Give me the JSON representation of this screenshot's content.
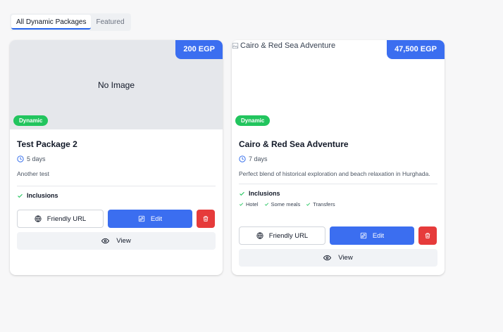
{
  "tabs": [
    {
      "label": "All Dynamic Packages",
      "active": true
    },
    {
      "label": "Featured",
      "active": false
    }
  ],
  "cards": [
    {
      "title": "Test Package 2",
      "price": "200 EGP",
      "badge": "Dynamic",
      "image_text": "No Image",
      "duration": "5 days",
      "description": "Another test",
      "inclusions_label": "Inclusions",
      "inclusions": [],
      "buttons": {
        "url": "Friendly URL",
        "edit": "Edit",
        "view": "View"
      }
    },
    {
      "title": "Cairo & Red Sea Adventure",
      "price": "47,500 EGP",
      "badge": "Dynamic",
      "image_alt": "Cairo & Red Sea Adventure",
      "duration": "7 days",
      "description": "Perfect blend of historical exploration and beach relaxation in Hurghada.",
      "inclusions_label": "Inclusions",
      "inclusions": [
        "Hotel",
        "Some meals",
        "Transfers"
      ],
      "buttons": {
        "url": "Friendly URL",
        "edit": "Edit",
        "view": "View"
      }
    }
  ],
  "colors": {
    "primary": "#3b6ef0",
    "danger": "#e63b3b",
    "success": "#22c55e"
  }
}
